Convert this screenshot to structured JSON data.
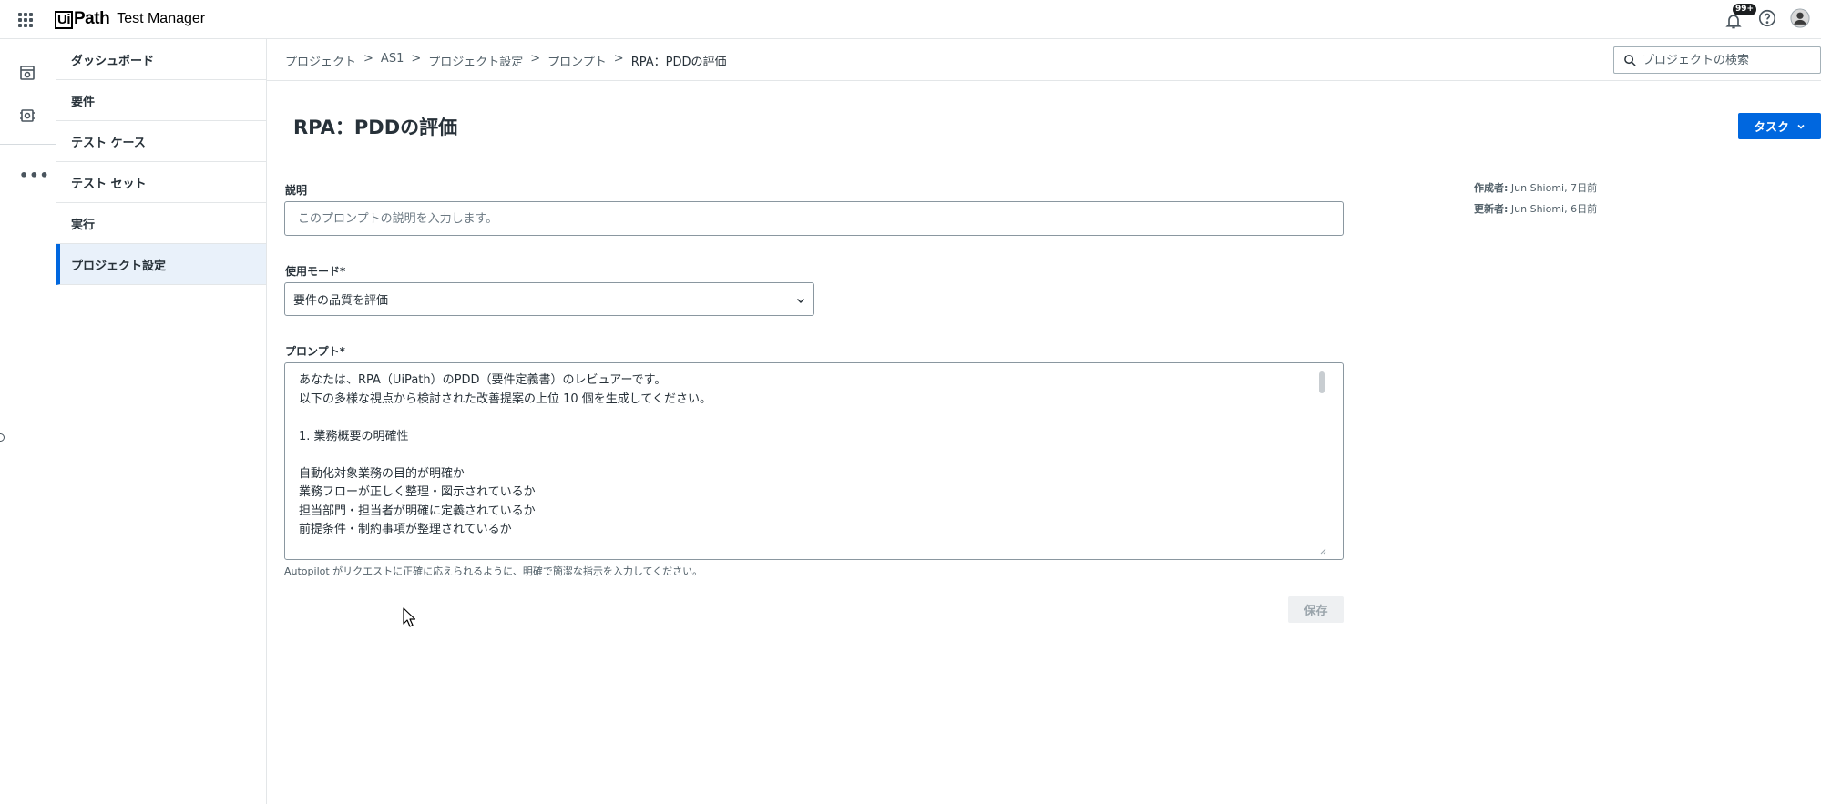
{
  "app": {
    "brand": "UiPath",
    "brand_prefix": "Ui",
    "brand_suffix": "Path",
    "product": "Test Manager",
    "notification_badge": "99+"
  },
  "nav": {
    "items": [
      {
        "label": "ダッシュボード",
        "active": false
      },
      {
        "label": "要件",
        "active": false
      },
      {
        "label": "テスト ケース",
        "active": false
      },
      {
        "label": "テスト セット",
        "active": false
      },
      {
        "label": "実行",
        "active": false
      },
      {
        "label": "プロジェクト設定",
        "active": true
      }
    ]
  },
  "breadcrumb": {
    "items": [
      "プロジェクト",
      "AS1",
      "プロジェクト設定",
      "プロンプト",
      "RPA：PDDの評価"
    ],
    "separator": ">"
  },
  "search": {
    "placeholder": "プロジェクトの検索"
  },
  "page": {
    "title": "RPA：PDDの評価",
    "task_button": "タスク"
  },
  "form": {
    "description_label": "説明",
    "description_placeholder": "このプロンプトの説明を入力します。",
    "mode_label": "使用モード*",
    "mode_value": "要件の品質を評価",
    "prompt_label": "プロンプト*",
    "prompt_lines": [
      "あなたは、RPA（UiPath）のPDD（要件定義書）のレビュアーです。",
      "以下の多様な視点から検討された改善提案の上位 10 個を生成してください。",
      "",
      "1. 業務概要の明確性",
      "",
      "自動化対象業務の目的が明確か",
      "業務フローが正しく整理・図示されているか",
      "担当部門・担当者が明確に定義されているか",
      "前提条件・制約事項が整理されているか"
    ],
    "prompt_help": "Autopilot がリクエストに正確に応えられるように、明確で簡潔な指示を入力してください。",
    "save_button": "保存"
  },
  "meta": {
    "created_label": "作成者:",
    "created_value": "Jun Shiomi, 7日前",
    "updated_label": "更新者:",
    "updated_value": "Jun Shiomi, 6日前"
  },
  "colors": {
    "accent": "#0067df",
    "nav_active_bg": "#e9f1fa",
    "border": "#e3e6e8",
    "text": "#273139"
  }
}
